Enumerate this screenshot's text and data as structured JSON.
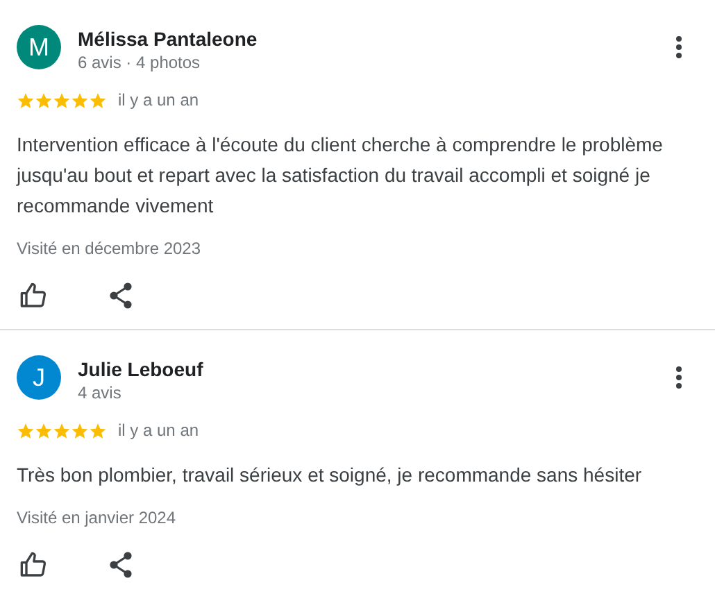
{
  "reviews": [
    {
      "initial": "M",
      "color": "#00897b",
      "name": "Mélissa Pantaleone",
      "meta": "6 avis · 4 photos",
      "stars": 5,
      "time": "il y a un an",
      "text": "Intervention efficace à l'écoute du client cherche à comprendre le problème jusqu'au bout et repart avec la satisfaction du travail accompli et soigné je recommande vivement",
      "visited": "Visité en décembre 2023"
    },
    {
      "initial": "J",
      "color": "#0288d1",
      "name": "Julie Leboeuf",
      "meta": "4 avis",
      "stars": 5,
      "time": "il y a un an",
      "text": "Très bon plombier, travail sérieux et soigné, je recommande sans hésiter",
      "visited": "Visité en janvier 2024"
    }
  ]
}
